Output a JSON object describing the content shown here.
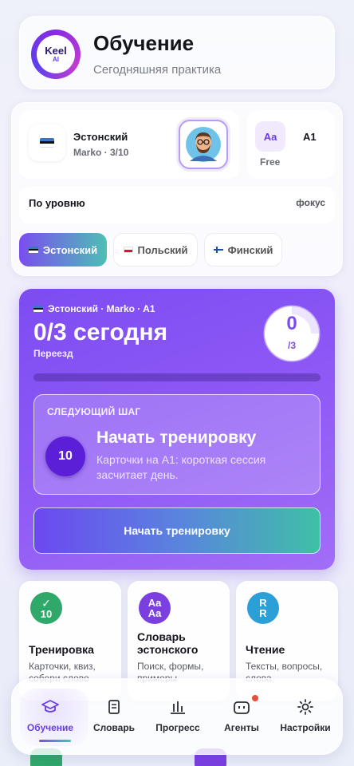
{
  "header": {
    "logo": {
      "line1": "Keel",
      "line2": "AI"
    },
    "title": "Обучение",
    "subtitle": "Сегодняшняя практика"
  },
  "current_language": {
    "name": "Эстонский",
    "tutor_progress": "Marko · 3/10",
    "flag_icon": "estonia-flag-icon",
    "avatar_icon": "tutor-avatar-icon"
  },
  "level": {
    "icon_text": "Aa",
    "value": "A1",
    "plan": "Free"
  },
  "filter": {
    "label": "По уровню",
    "action": "фокус"
  },
  "language_chips": [
    {
      "label": "Эстонский",
      "flag": "estonia",
      "active": true
    },
    {
      "label": "Польский",
      "flag": "poland",
      "active": false
    },
    {
      "label": "Финский",
      "flag": "finland",
      "active": false
    }
  ],
  "hero": {
    "context": "Эстонский · Marko · A1",
    "count_text": "0/3 сегодня",
    "topic": "Переезд",
    "ring_value": "0",
    "ring_total": "/3",
    "progress_fraction": 0,
    "next_step": {
      "label": "СЛЕДУЮЩИЙ ШАГ",
      "badge": "10",
      "title": "Начать тренировку",
      "description": "Карточки на A1: короткая сессия засчитает день."
    },
    "cta_label": "Начать тренировку"
  },
  "features": [
    {
      "icon_text": "10",
      "title": "Тренировка",
      "description": "Карточки, квиз, собери слово",
      "color": "#2fa86a"
    },
    {
      "icon_text": "Aa Aa",
      "title": "Словарь эстонского",
      "description": "Поиск, формы, примеры",
      "color": "#7b3fe0"
    },
    {
      "icon_text": "R R",
      "title": "Чтение",
      "description": "Тексты, вопросы, слова",
      "color": "#2b9fd6"
    }
  ],
  "nav": {
    "items": [
      {
        "label": "Обучение",
        "icon": "graduation-cap-icon",
        "active": true
      },
      {
        "label": "Словарь",
        "icon": "book-icon",
        "active": false
      },
      {
        "label": "Прогресс",
        "icon": "bar-chart-icon",
        "active": false
      },
      {
        "label": "Агенты",
        "icon": "robot-icon",
        "active": false,
        "badge": true
      },
      {
        "label": "Настройки",
        "icon": "gear-icon",
        "active": false
      }
    ]
  },
  "colors": {
    "accent": "#7b4df0",
    "teal": "#3fc0a7",
    "badge_red": "#e8503d"
  }
}
